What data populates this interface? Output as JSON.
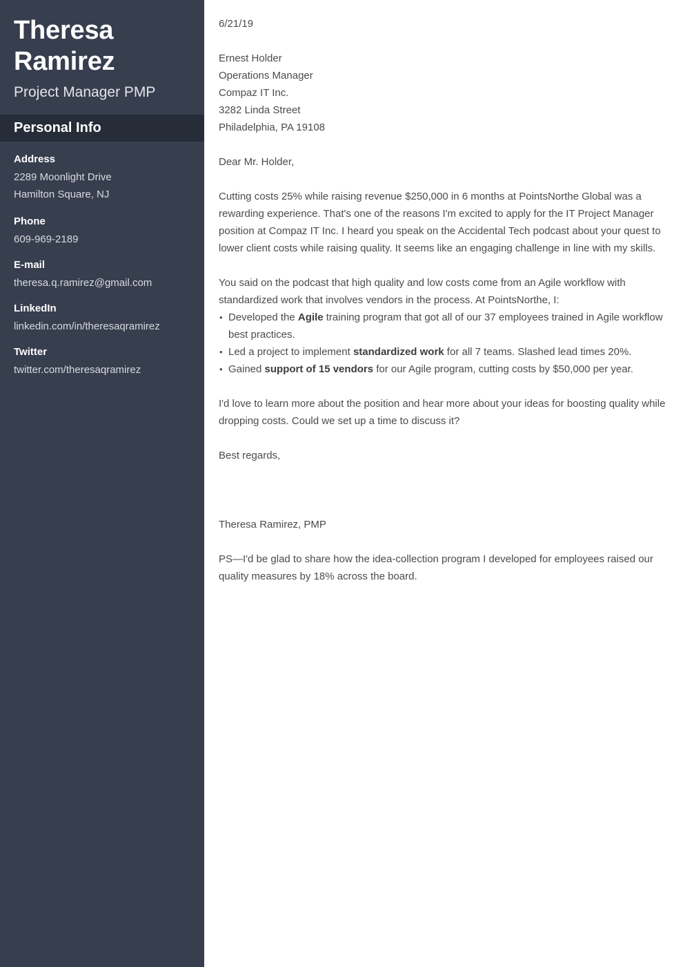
{
  "sidebar": {
    "name": "Theresa Ramirez",
    "job_title": "Project Manager PMP",
    "section_title": "Personal Info",
    "contacts": [
      {
        "label": "Address",
        "value_line1": "2289 Moonlight Drive",
        "value_line2": "Hamilton Square, NJ"
      },
      {
        "label": "Phone",
        "value_line1": "609-969-2189"
      },
      {
        "label": "E-mail",
        "value_line1": "theresa.q.ramirez@gmail.com"
      },
      {
        "label": "LinkedIn",
        "value_line1": "linkedin.com/in/theresaqramirez"
      },
      {
        "label": "Twitter",
        "value_line1": "twitter.com/theresaqramirez"
      }
    ]
  },
  "letter": {
    "date": "6/21/19",
    "recipient": {
      "name": "Ernest Holder",
      "title": "Operations Manager",
      "company": "Compaz IT Inc.",
      "street": "3282 Linda Street",
      "city_state_zip": "Philadelphia, PA 19108"
    },
    "salutation": "Dear Mr. Holder,",
    "paragraph_1": "Cutting costs 25% while raising revenue $250,000 in 6 months at PointsNorthe Global was a rewarding experience. That's one of the reasons I'm excited to apply for the IT Project Manager position at Compaz IT Inc. I heard you speak on the Accidental Tech podcast about your quest to lower client costs while raising quality. It seems like an engaging challenge in line with my skills.",
    "paragraph_2": "You said on the podcast that high quality and low costs come from an Agile workflow with standardized work that involves vendors in the process. At PointsNorthe, I:",
    "bullets": [
      {
        "before": "Developed the ",
        "bold": "Agile",
        "after": " training program that got all of our 37 employees trained in Agile workflow best practices."
      },
      {
        "before": "Led a project to implement ",
        "bold": "standardized work",
        "after": " for all 7 teams. Slashed lead times 20%."
      },
      {
        "before": "Gained ",
        "bold": "support of 15 vendors",
        "after": " for our Agile program, cutting costs by $50,000 per year."
      }
    ],
    "paragraph_3": "I'd love to learn more about the position and hear more about your ideas for boosting quality while dropping costs. Could we set up a time to discuss it?",
    "signoff": "Best regards,",
    "signature": "Theresa Ramirez, PMP",
    "postscript": "PS—I'd be glad to share how the idea-collection program I developed for employees raised our quality measures by 18% across the board."
  },
  "colors": {
    "sidebar_bg": "#373e4e",
    "section_band_bg": "#262c38",
    "page_bg": "#ffffff",
    "body_text": "#4b4b4b",
    "sidebar_label": "#ffffff",
    "sidebar_value": "#d9dbe0"
  }
}
